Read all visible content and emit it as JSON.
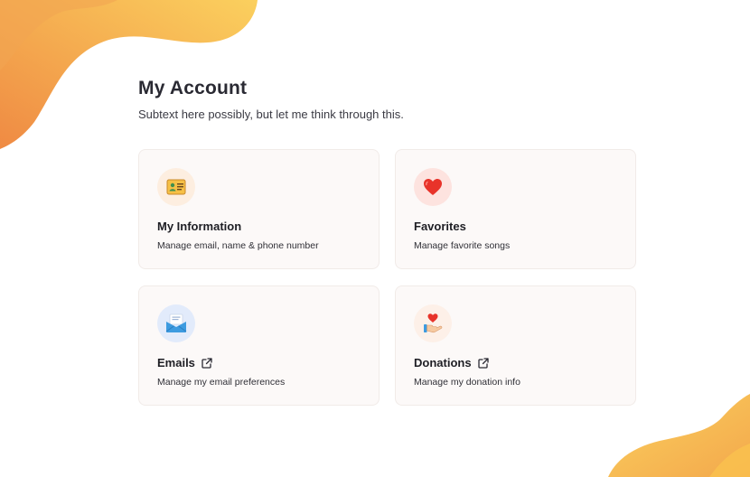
{
  "header": {
    "title": "My Account",
    "subtitle": "Subtext here possibly, but let me think through this."
  },
  "cards": [
    {
      "title": "My Information",
      "description": "Manage email, name & phone number",
      "icon": "id-card-icon",
      "icon_bg": "#fdeee0",
      "external": false
    },
    {
      "title": "Favorites",
      "description": "Manage favorite songs",
      "icon": "heart-icon",
      "icon_bg": "#fde3df",
      "external": false
    },
    {
      "title": "Emails",
      "description": "Manage my email preferences",
      "icon": "envelope-icon",
      "icon_bg": "#e2ebfb",
      "external": true
    },
    {
      "title": "Donations",
      "description": "Manage my donation info",
      "icon": "donation-hand-icon",
      "icon_bg": "#fdf0e8",
      "external": true
    }
  ],
  "colors": {
    "blob_light": "#fbd05e",
    "blob_dark": "#ef8a43",
    "card_bg": "#fcf9f8",
    "card_border": "#f1ebe8",
    "heart_red": "#e8332a",
    "envelope_blue": "#3d9be0"
  }
}
